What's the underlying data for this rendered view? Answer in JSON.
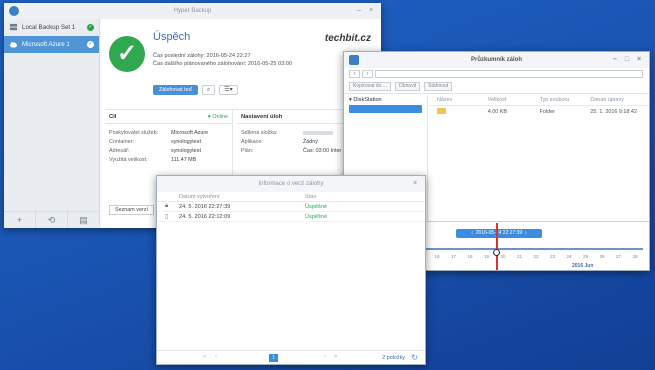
{
  "hyper_backup": {
    "title": "Hyper Backup",
    "tasks": [
      {
        "label": "Local Backup Set 1"
      },
      {
        "label": "Microsoft Azure 1"
      }
    ],
    "status_title": "Úspěch",
    "brand": "techbit.cz",
    "last_backup": "Čas poslední zálohy: 2016-05-24 22:27",
    "next_backup": "Čas dalšího plánovaného zálohování: 2016-05-25 03:00",
    "backup_now_label": "Zálohovat teď",
    "target_header": "Cíl",
    "online_label": "Online",
    "target_rows": [
      {
        "key": "Poskytovatel služeb:",
        "value": "Microsoft Azure"
      },
      {
        "key": "Container:",
        "value": "synologytest"
      },
      {
        "key": "Adresář:",
        "value": "synologytest"
      },
      {
        "key": "Využitá velikost:",
        "value": "111.47 MB"
      }
    ],
    "settings_header": "Nastavení úloh",
    "settings_rows": [
      {
        "key": "Sdílená složka:",
        "value": ""
      },
      {
        "key": "Aplikace:",
        "value": "Žádný"
      },
      {
        "key": "Plán:",
        "value": "Čas: 03:00 Inter"
      }
    ],
    "version_list_label": "Seznam verzí"
  },
  "explorer": {
    "title": "Průzkumník záloh",
    "toolbar": {
      "copy_label": "Kopírovat do ...",
      "restore_label": "Obnovit",
      "download_label": "Stáhnout"
    },
    "tree_root": "DiskStation",
    "tree_selected": "",
    "columns": [
      "Název",
      "Velikost",
      "Typ souboru",
      "Datum úpravy"
    ],
    "rows": [
      {
        "name": "",
        "size": "4.00 KB",
        "type": "Folder",
        "modified": "25. 1. 2016 9:18:42"
      }
    ],
    "timeline": {
      "current": "2016-05-24 22:27:39",
      "ticks": [
        "11",
        "12",
        "13",
        "14",
        "15",
        "16",
        "17",
        "18",
        "19",
        "20",
        "21",
        "22",
        "23",
        "24",
        "25",
        "26",
        "27",
        "28"
      ],
      "month_label": "2016 Jun"
    }
  },
  "version_info": {
    "title": "Informace o verzi zálohy",
    "columns": [
      "Datum vytvoření",
      "Stav"
    ],
    "rows": [
      {
        "date": "24. 5. 2016 22:27:39",
        "status": "Úspěšné",
        "locked": true
      },
      {
        "date": "24. 5. 2016 22:12:09",
        "status": "Úspěšné",
        "locked": false
      }
    ],
    "page": "1",
    "count_label": "2 položky"
  }
}
